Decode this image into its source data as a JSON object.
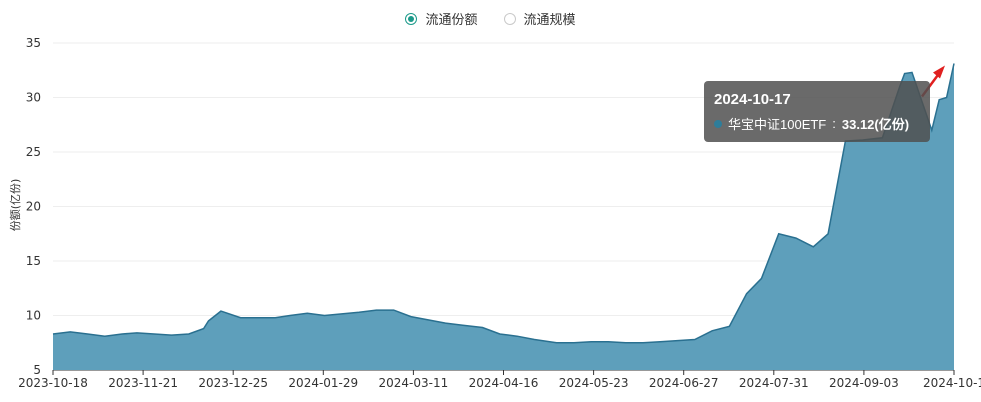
{
  "legend": {
    "items": [
      {
        "label": "流通份额",
        "selected": true
      },
      {
        "label": "流通规模",
        "selected": false
      }
    ]
  },
  "tooltip": {
    "date": "2024-10-17",
    "series_name": "华宝中证100ETF",
    "value": "33.12(亿份)"
  },
  "colors": {
    "area_fill": "#5e9fbb",
    "line": "#2a7090",
    "accent": "#1c9a8a",
    "arrow": "#e02020"
  },
  "chart_data": {
    "type": "area",
    "title": "",
    "xlabel": "",
    "ylabel": "份额(亿份)",
    "ylim": [
      5,
      35
    ],
    "yticks": [
      5,
      10,
      15,
      20,
      25,
      30,
      35
    ],
    "xticks": [
      "2023-10-18",
      "2023-11-21",
      "2023-12-25",
      "2024-01-29",
      "2024-03-11",
      "2024-04-16",
      "2024-05-23",
      "2024-06-27",
      "2024-07-31",
      "2024-09-03",
      "2024-10-1"
    ],
    "grid": true,
    "legend_position": "top-center",
    "series": [
      {
        "name": "华宝中证100ETF",
        "x": [
          "2023-10-18",
          "2023-10-25",
          "2023-11-01",
          "2023-11-08",
          "2023-11-15",
          "2023-11-21",
          "2023-11-28",
          "2023-12-05",
          "2023-12-12",
          "2023-12-18",
          "2023-12-20",
          "2023-12-25",
          "2024-01-02",
          "2024-01-09",
          "2024-01-16",
          "2024-01-22",
          "2024-01-29",
          "2024-02-05",
          "2024-02-19",
          "2024-02-26",
          "2024-03-04",
          "2024-03-11",
          "2024-03-18",
          "2024-03-25",
          "2024-04-01",
          "2024-04-09",
          "2024-04-16",
          "2024-04-23",
          "2024-04-30",
          "2024-05-09",
          "2024-05-16",
          "2024-05-23",
          "2024-05-30",
          "2024-06-06",
          "2024-06-13",
          "2024-06-20",
          "2024-06-27",
          "2024-07-04",
          "2024-07-11",
          "2024-07-18",
          "2024-07-25",
          "2024-07-31",
          "2024-08-07",
          "2024-08-14",
          "2024-08-21",
          "2024-08-27",
          "2024-09-03",
          "2024-09-10",
          "2024-09-18",
          "2024-09-25",
          "2024-09-27",
          "2024-09-30",
          "2024-10-08",
          "2024-10-11",
          "2024-10-14",
          "2024-10-17"
        ],
        "values": [
          8.3,
          8.5,
          8.3,
          8.1,
          8.3,
          8.4,
          8.3,
          8.2,
          8.3,
          8.8,
          9.5,
          10.4,
          9.8,
          9.8,
          9.8,
          10.0,
          10.2,
          10.0,
          10.3,
          10.5,
          10.5,
          9.9,
          9.6,
          9.3,
          9.1,
          8.9,
          8.3,
          8.1,
          7.8,
          7.5,
          7.5,
          7.6,
          7.6,
          7.5,
          7.5,
          7.6,
          7.7,
          7.8,
          8.6,
          9.0,
          12.0,
          13.4,
          17.5,
          17.1,
          16.3,
          17.5,
          26.0,
          26.1,
          26.3,
          31.0,
          32.2,
          32.3,
          27.0,
          29.8,
          30.0,
          33.12
        ]
      }
    ]
  }
}
